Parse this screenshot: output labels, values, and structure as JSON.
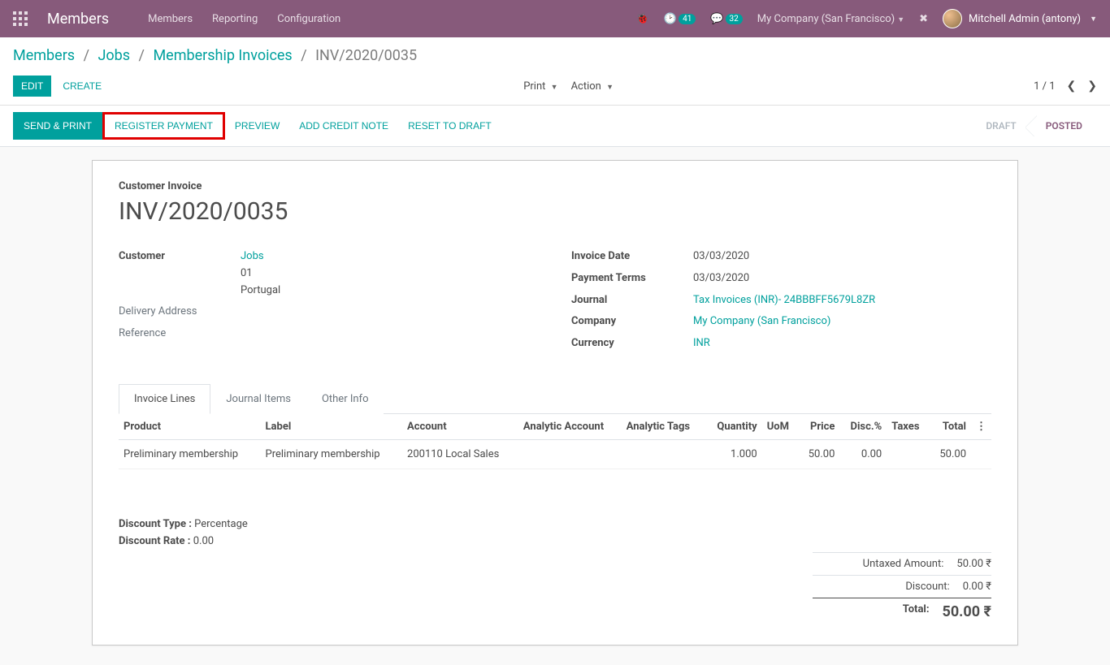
{
  "nav": {
    "brand": "Members",
    "links": {
      "members": "Members",
      "reporting": "Reporting",
      "configuration": "Configuration"
    },
    "badge_activities": "41",
    "badge_messages": "32",
    "company": "My Company (San Francisco)",
    "user": "Mitchell Admin (antony)"
  },
  "breadcrumb": {
    "items": [
      {
        "label": "Members"
      },
      {
        "label": "Jobs"
      },
      {
        "label": "Membership Invoices"
      }
    ],
    "current": "INV/2020/0035"
  },
  "cp": {
    "edit": "EDIT",
    "create": "CREATE",
    "print": "Print",
    "action": "Action",
    "pager": "1 / 1"
  },
  "statusbar": {
    "send_print": "SEND & PRINT",
    "register_payment": "REGISTER PAYMENT",
    "preview": "PREVIEW",
    "add_credit": "ADD CREDIT NOTE",
    "reset_draft": "RESET TO DRAFT",
    "status_draft": "DRAFT",
    "status_posted": "POSTED"
  },
  "invoice": {
    "title_label": "Customer Invoice",
    "number": "INV/2020/0035",
    "left": {
      "customer_label": "Customer",
      "customer_name": "Jobs",
      "customer_addr1": "01",
      "customer_addr2": "Portugal",
      "delivery_label": "Delivery Address",
      "reference_label": "Reference"
    },
    "right": {
      "date_label": "Invoice Date",
      "date_value": "03/03/2020",
      "terms_label": "Payment Terms",
      "terms_value": "03/03/2020",
      "journal_label": "Journal",
      "journal_value": "Tax Invoices (INR)- 24BBBFF5679L8ZR",
      "company_label": "Company",
      "company_value": "My Company (San Francisco)",
      "currency_label": "Currency",
      "currency_value": "INR"
    }
  },
  "tabs": {
    "lines": "Invoice Lines",
    "journal": "Journal Items",
    "other": "Other Info"
  },
  "table": {
    "hdr": {
      "product": "Product",
      "label": "Label",
      "account": "Account",
      "analytic_acc": "Analytic Account",
      "analytic_tags": "Analytic Tags",
      "qty": "Quantity",
      "uom": "UoM",
      "price": "Price",
      "disc": "Disc.%",
      "taxes": "Taxes",
      "total": "Total"
    },
    "row": {
      "product": "Preliminary membership",
      "label": "Preliminary membership",
      "account": "200110 Local Sales",
      "qty": "1.000",
      "price": "50.00",
      "disc": "0.00",
      "total": "50.00"
    }
  },
  "discount": {
    "type_label": "Discount Type :",
    "type_value": "Percentage",
    "rate_label": "Discount Rate :",
    "rate_value": "0.00"
  },
  "totals": {
    "untaxed_label": "Untaxed Amount:",
    "untaxed_value": "50.00 ₹",
    "discount_label": "Discount:",
    "discount_value": "0.00 ₹",
    "total_label": "Total:",
    "total_value": "50.00 ₹"
  }
}
